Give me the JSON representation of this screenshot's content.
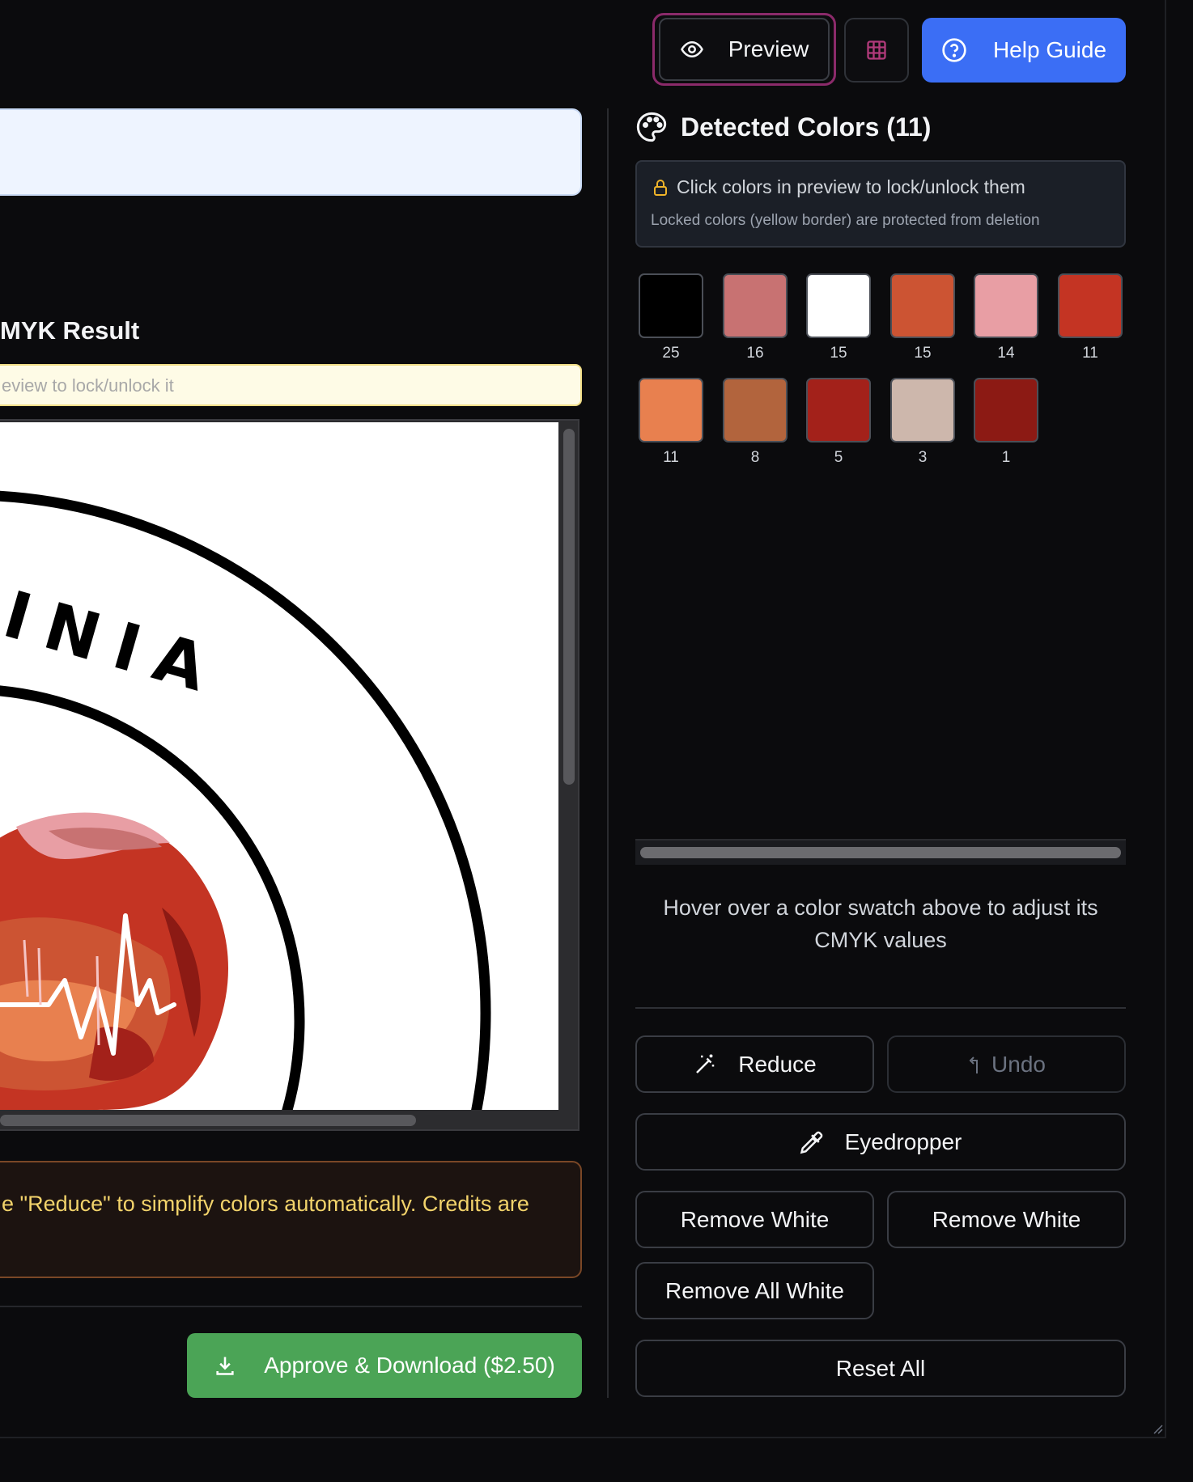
{
  "toolbar": {
    "preview_label": "Preview",
    "help_label": "Help Guide",
    "icons": {
      "preview": "eye-icon",
      "grid": "grid-icon",
      "help": "help-circle-icon"
    },
    "colors": {
      "help_bg": "#3b6ef5",
      "preview_ring": "#8b2a6a",
      "grid_icon": "#b03a7a"
    }
  },
  "left": {
    "result_title": "MYK Result",
    "lock_hint": "eview to lock/unlock it",
    "artwork_text": "INIA",
    "info_text": "e \"Reduce\" to simplify colors automatically. Credits are",
    "approve_label": "Approve & Download ($2.50)",
    "colors": {
      "approve_bg": "#4ba456",
      "info_text": "#f2d36b"
    }
  },
  "panel": {
    "title": "Detected Colors (11)",
    "notice_main": "Click colors in preview to lock/unlock them",
    "notice_sub": "Locked colors (yellow border) are protected from deletion",
    "swatches": [
      {
        "color": "#000000",
        "count": "25"
      },
      {
        "color": "#c87272",
        "count": "16"
      },
      {
        "color": "#ffffff",
        "count": "15"
      },
      {
        "color": "#cc5433",
        "count": "15"
      },
      {
        "color": "#e89ea4",
        "count": "14"
      },
      {
        "color": "#c43423",
        "count": "11"
      },
      {
        "color": "#e8804f",
        "count": "11"
      },
      {
        "color": "#b2643d",
        "count": "8"
      },
      {
        "color": "#a3211a",
        "count": "5"
      },
      {
        "color": "#cdb7ac",
        "count": "3"
      },
      {
        "color": "#8c1a14",
        "count": "1"
      }
    ],
    "hover_hint": "Hover over a color swatch above to adjust its CMYK values",
    "buttons": {
      "reduce": "Reduce",
      "undo": "Undo",
      "eyedropper": "Eyedropper",
      "remove_white_1": "Remove White",
      "remove_white_2": "Remove White",
      "remove_all_white": "Remove All White",
      "reset_all": "Reset All"
    },
    "icons": {
      "title": "palette-icon",
      "notice": "lock-icon",
      "reduce": "magic-wand-icon",
      "undo": "undo-icon",
      "eyedropper": "eyedropper-icon"
    }
  }
}
